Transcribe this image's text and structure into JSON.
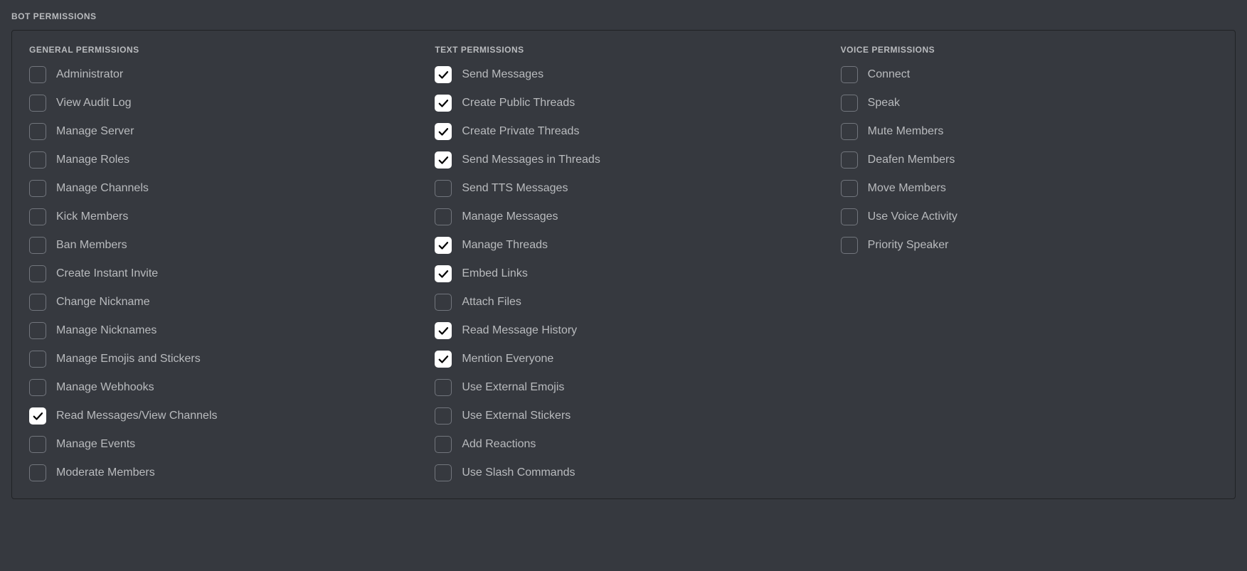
{
  "section_title": "BOT PERMISSIONS",
  "columns": [
    {
      "heading": "GENERAL PERMISSIONS",
      "items": [
        {
          "label": "Administrator",
          "checked": false
        },
        {
          "label": "View Audit Log",
          "checked": false
        },
        {
          "label": "Manage Server",
          "checked": false
        },
        {
          "label": "Manage Roles",
          "checked": false
        },
        {
          "label": "Manage Channels",
          "checked": false
        },
        {
          "label": "Kick Members",
          "checked": false
        },
        {
          "label": "Ban Members",
          "checked": false
        },
        {
          "label": "Create Instant Invite",
          "checked": false
        },
        {
          "label": "Change Nickname",
          "checked": false
        },
        {
          "label": "Manage Nicknames",
          "checked": false
        },
        {
          "label": "Manage Emojis and Stickers",
          "checked": false
        },
        {
          "label": "Manage Webhooks",
          "checked": false
        },
        {
          "label": "Read Messages/View Channels",
          "checked": true
        },
        {
          "label": "Manage Events",
          "checked": false
        },
        {
          "label": "Moderate Members",
          "checked": false
        }
      ]
    },
    {
      "heading": "TEXT PERMISSIONS",
      "items": [
        {
          "label": "Send Messages",
          "checked": true
        },
        {
          "label": "Create Public Threads",
          "checked": true
        },
        {
          "label": "Create Private Threads",
          "checked": true
        },
        {
          "label": "Send Messages in Threads",
          "checked": true
        },
        {
          "label": "Send TTS Messages",
          "checked": false
        },
        {
          "label": "Manage Messages",
          "checked": false
        },
        {
          "label": "Manage Threads",
          "checked": true
        },
        {
          "label": "Embed Links",
          "checked": true
        },
        {
          "label": "Attach Files",
          "checked": false
        },
        {
          "label": "Read Message History",
          "checked": true
        },
        {
          "label": "Mention Everyone",
          "checked": true
        },
        {
          "label": "Use External Emojis",
          "checked": false
        },
        {
          "label": "Use External Stickers",
          "checked": false
        },
        {
          "label": "Add Reactions",
          "checked": false
        },
        {
          "label": "Use Slash Commands",
          "checked": false
        }
      ]
    },
    {
      "heading": "VOICE PERMISSIONS",
      "items": [
        {
          "label": "Connect",
          "checked": false
        },
        {
          "label": "Speak",
          "checked": false
        },
        {
          "label": "Mute Members",
          "checked": false
        },
        {
          "label": "Deafen Members",
          "checked": false
        },
        {
          "label": "Move Members",
          "checked": false
        },
        {
          "label": "Use Voice Activity",
          "checked": false
        },
        {
          "label": "Priority Speaker",
          "checked": false
        }
      ]
    }
  ]
}
